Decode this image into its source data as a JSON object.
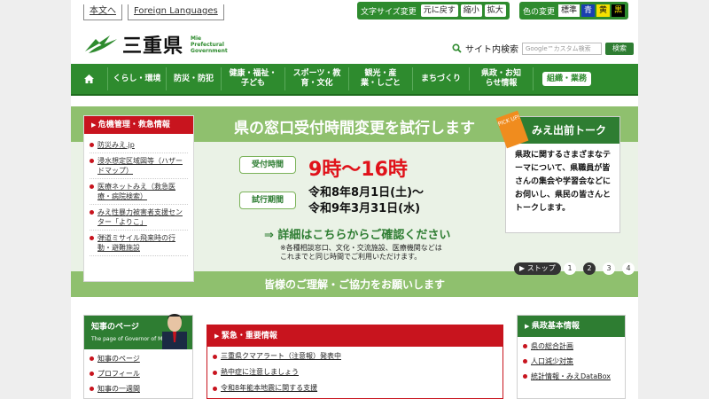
{
  "utility": {
    "honbun": "本文へ",
    "foreign": "Foreign Languages",
    "fontsize_label": "文字サイズ変更",
    "fontsize_buttons": [
      "元に戻す",
      "縮小",
      "拡大"
    ],
    "color_label": "色の変更",
    "color_buttons": [
      "標準",
      "青",
      "黄",
      "黒"
    ]
  },
  "header": {
    "logo_text": "三重県",
    "logo_en_1": "Mie",
    "logo_en_2": "Prefectural",
    "logo_en_3": "Government",
    "search_label": "サイト内検索",
    "search_placeholder": "Google™カスタム検索",
    "search_button": "検索"
  },
  "nav": {
    "items": [
      "くらし・環境",
      "防災・防犯",
      "健康・福祉・子ども",
      "スポーツ・教育・文化",
      "観光・産業・しごと",
      "まちづくり",
      "県政・お知らせ情報",
      "組織・業務"
    ]
  },
  "emergency": {
    "title": "危機管理・救急情報",
    "links": [
      "防災みえ.jp",
      "浸水想定区域図等（ハザードマップ）",
      "医療ネットみえ（救急医療・病院検索）",
      "みえ性暴力被害者支援センター「よりこ」",
      "弾道ミサイル飛来時の行動・避難施設"
    ]
  },
  "hero": {
    "title": "県の窓口受付時間変更を試行します",
    "label_hours": "受付時間",
    "hours": "9時～16時",
    "label_period": "試行期間",
    "period_1": "令和8年8月1日(土)～",
    "period_2": "令和9年3月31日(水)",
    "detail": "⇒ 詳細はこちらからご確認ください",
    "note_1": "※各種相談窓口、文化・交流施設、医療機関などは",
    "note_2": "これまでと同じ時間でご利用いただけます。",
    "bottom": "皆様のご理解・ご協力をお願いします",
    "stop": "ストップ",
    "pages": [
      "1",
      "2",
      "3",
      "4"
    ],
    "active_page": "2"
  },
  "pickup": {
    "tag": "PICK UP!",
    "title": "みえ出前トーク",
    "text": "県政に関するさまざまなテーマについて、県職員が皆さんの集会や学習会などにお伺いし、県民の皆さんとトークします。"
  },
  "governor": {
    "title": "知事のページ",
    "subtitle": "The page of Governor of Mie",
    "links": [
      "知事のページ",
      "プロフィール",
      "知事の一週間"
    ]
  },
  "urgent": {
    "title": "緊急・重要情報",
    "links": [
      "三重県クマアラート（注意報）発表中",
      "熱中症に注意しましょう",
      "令和8年能本地震に関する支援"
    ]
  },
  "basic": {
    "title": "県政基本情報",
    "links": [
      "県の総合計画",
      "人口減少対策",
      "統計情報・みえDataBox"
    ]
  },
  "colors": {
    "green": "#2e8b2e",
    "red": "#c8141e",
    "light_green": "#8fc06e"
  }
}
